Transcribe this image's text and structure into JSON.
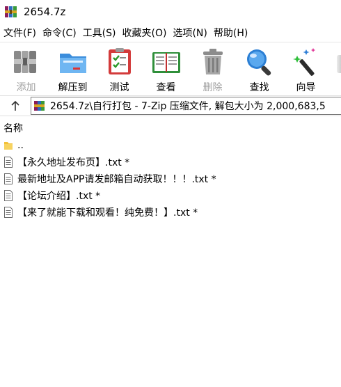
{
  "window": {
    "title": "2654.7z"
  },
  "menu": [
    {
      "label": "文件(F)",
      "id": "file"
    },
    {
      "label": "命令(C)",
      "id": "command"
    },
    {
      "label": "工具(S)",
      "id": "tools"
    },
    {
      "label": "收藏夹(O)",
      "id": "favorites"
    },
    {
      "label": "选项(N)",
      "id": "options"
    },
    {
      "label": "帮助(H)",
      "id": "help"
    }
  ],
  "toolbar": {
    "add": {
      "label": "添加",
      "icon": "add-archive-icon",
      "enabled": false
    },
    "extract": {
      "label": "解压到",
      "icon": "folder-extract-icon",
      "enabled": true
    },
    "test": {
      "label": "测试",
      "icon": "test-clipboard-icon",
      "enabled": true
    },
    "view": {
      "label": "查看",
      "icon": "book-view-icon",
      "enabled": true
    },
    "delete": {
      "label": "删除",
      "icon": "trash-icon",
      "enabled": false
    },
    "find": {
      "label": "查找",
      "icon": "magnifier-icon",
      "enabled": true
    },
    "wizard": {
      "label": "向导",
      "icon": "magic-wand-icon",
      "enabled": true
    }
  },
  "address": {
    "path": "2654.7z\\自行打包 - 7-Zip 压缩文件, 解包大小为 2,000,683,5"
  },
  "list": {
    "column_name": "名称",
    "items": [
      {
        "name": "..",
        "type": "parent-folder"
      },
      {
        "name": "【永久地址发布页】.txt *",
        "type": "file"
      },
      {
        "name": "最新地址及APP请发邮箱自动获取！！！.txt *",
        "type": "file"
      },
      {
        "name": "【论坛介绍】.txt *",
        "type": "file"
      },
      {
        "name": "【来了就能下载和观看！纯免费！】.txt *",
        "type": "file"
      }
    ]
  },
  "colors": {
    "disabled_text": "#a0a0a0",
    "border": "#7a7a7a",
    "folder": "#f2c037",
    "accent_blue": "#2f7fd6"
  }
}
